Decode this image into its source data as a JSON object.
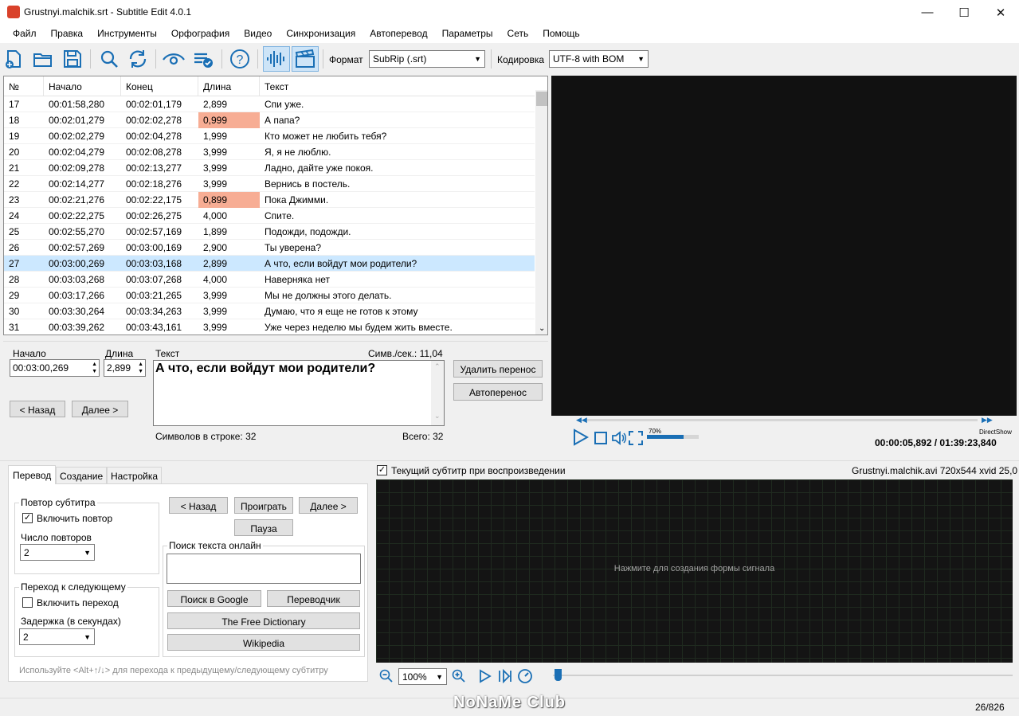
{
  "window": {
    "title": "Grustnyi.malchik.srt - Subtitle Edit 4.0.1"
  },
  "menu": [
    "Файл",
    "Правка",
    "Инструменты",
    "Орфография",
    "Видео",
    "Синхронизация",
    "Автоперевод",
    "Параметры",
    "Сеть",
    "Помощь"
  ],
  "toolbar": {
    "format_label": "Формат",
    "format_value": "SubRip (.srt)",
    "encoding_label": "Кодировка",
    "encoding_value": "UTF-8 with BOM"
  },
  "grid": {
    "headers": [
      "№",
      "Начало",
      "Конец",
      "Длина",
      "Текст"
    ],
    "rows": [
      {
        "n": "17",
        "start": "00:01:58,280",
        "end": "00:02:01,179",
        "dur": "2,899",
        "text": "Спи уже."
      },
      {
        "n": "18",
        "start": "00:02:01,279",
        "end": "00:02:02,278",
        "dur": "0,999",
        "text": "А папа?"
      },
      {
        "n": "19",
        "start": "00:02:02,279",
        "end": "00:02:04,278",
        "dur": "1,999",
        "text": "Кто может не любить тебя?"
      },
      {
        "n": "20",
        "start": "00:02:04,279",
        "end": "00:02:08,278",
        "dur": "3,999",
        "text": "Я, я не люблю."
      },
      {
        "n": "21",
        "start": "00:02:09,278",
        "end": "00:02:13,277",
        "dur": "3,999",
        "text": "Ладно, дайте уже покоя."
      },
      {
        "n": "22",
        "start": "00:02:14,277",
        "end": "00:02:18,276",
        "dur": "3,999",
        "text": "Вернись в постель."
      },
      {
        "n": "23",
        "start": "00:02:21,276",
        "end": "00:02:22,175",
        "dur": "0,899",
        "text": "Пока Джимми."
      },
      {
        "n": "24",
        "start": "00:02:22,275",
        "end": "00:02:26,275",
        "dur": "4,000",
        "text": "Спите."
      },
      {
        "n": "25",
        "start": "00:02:55,270",
        "end": "00:02:57,169",
        "dur": "1,899",
        "text": "Подожди, подожди."
      },
      {
        "n": "26",
        "start": "00:02:57,269",
        "end": "00:03:00,169",
        "dur": "2,900",
        "text": "Ты уверена?"
      },
      {
        "n": "27",
        "start": "00:03:00,269",
        "end": "00:03:03,168",
        "dur": "2,899",
        "text": "А что, если войдут мои родители?"
      },
      {
        "n": "28",
        "start": "00:03:03,268",
        "end": "00:03:07,268",
        "dur": "4,000",
        "text": "Наверняка нет"
      },
      {
        "n": "29",
        "start": "00:03:17,266",
        "end": "00:03:21,265",
        "dur": "3,999",
        "text": "Мы не должны этого делать."
      },
      {
        "n": "30",
        "start": "00:03:30,264",
        "end": "00:03:34,263",
        "dur": "3,999",
        "text": "Думаю, что я еще не готов к этому"
      },
      {
        "n": "31",
        "start": "00:03:39,262",
        "end": "00:03:43,161",
        "dur": "3,999",
        "text": "Уже через неделю мы будем жить вместе."
      }
    ]
  },
  "editor": {
    "start_label": "Начало",
    "start_value": "00:03:00,269",
    "dur_label": "Длина",
    "dur_value": "2,899",
    "text_label": "Текст",
    "cps": "Симв./сек.: 11,04",
    "text": "А что, если войдут мои родители?",
    "btn_unbreak": "Удалить перенос",
    "btn_autobreak": "Автоперенос",
    "btn_prev": "< Назад",
    "btn_next": "Далее >",
    "line_len": "Символов в строке: 32",
    "total": "Всего: 32"
  },
  "player": {
    "volume": "70%",
    "volume_level": 0.7,
    "engine": "DirectShow",
    "time": "00:00:05,892 / 01:39:23,840"
  },
  "tabs": [
    "Перевод",
    "Создание",
    "Настройка"
  ],
  "translate": {
    "repeat_group": "Повтор субтитра",
    "repeat_enable": "Включить повтор",
    "repeat_count_label": "Число повторов",
    "repeat_count": "2",
    "next_group": "Переход к следующему",
    "next_enable": "Включить переход",
    "delay_label": "Задержка (в секундах)",
    "delay": "2",
    "btn_prev": "< Назад",
    "btn_play": "Проиграть",
    "btn_next": "Далее >",
    "btn_pause": "Пауза",
    "search_group": "Поиск текста онлайн",
    "btn_google": "Поиск в Google",
    "btn_translator": "Переводчик",
    "btn_dict": "The Free Dictionary",
    "btn_wiki": "Wikipedia",
    "hint": "Используйте <Alt+↑/↓> для перехода к предыдущему/следующему субтитру"
  },
  "wave": {
    "current_sub_label": "Текущий субтитр при воспроизведении",
    "video_info": "Grustnyi.malchik.avi 720x544 xvid 25,0",
    "placeholder": "Нажмите для создания формы сигнала",
    "zoom": "100%"
  },
  "status": {
    "watermark": "NoNaMe Club",
    "position": "26/826"
  }
}
